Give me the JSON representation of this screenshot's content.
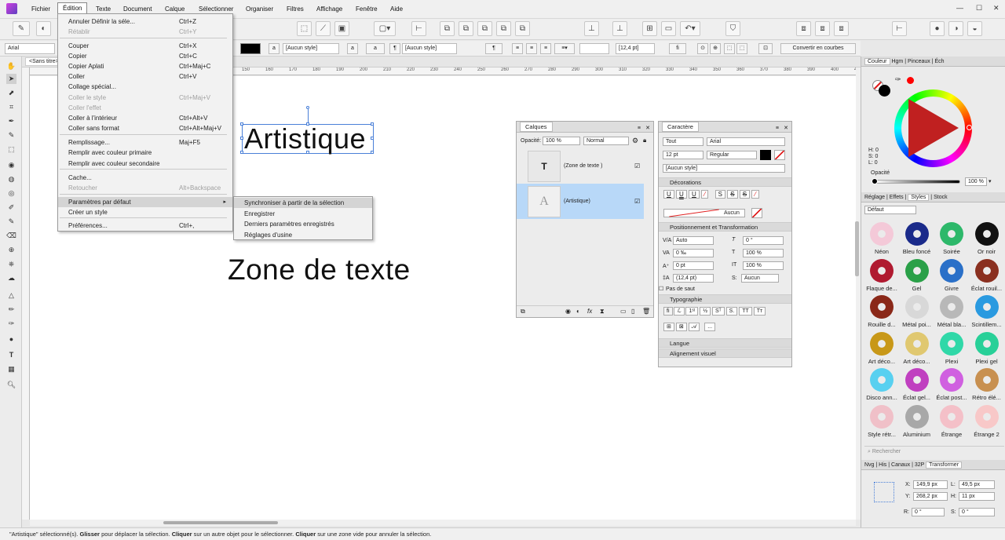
{
  "menubar": {
    "items": [
      "Fichier",
      "Édition",
      "Texte",
      "Document",
      "Calque",
      "Sélectionner",
      "Organiser",
      "Filtres",
      "Affichage",
      "Fenêtre",
      "Aide"
    ],
    "window_controls": [
      "—",
      "☐",
      "✕"
    ]
  },
  "context": {
    "font": "Arial",
    "style1": "[Aucun style]",
    "style2": "[Aucun style]",
    "size": "[12,4 pt]",
    "convert": "Convertir en courbes"
  },
  "document": {
    "tab": "<Sans titre>"
  },
  "ruler": {
    "ticks": [
      "150",
      "160",
      "170",
      "180",
      "190",
      "200",
      "210",
      "220",
      "230",
      "240",
      "250",
      "260",
      "270",
      "280",
      "290",
      "300",
      "310",
      "320",
      "330",
      "340",
      "350",
      "360",
      "370",
      "380",
      "390",
      "400",
      "410",
      "420",
      "430",
      "440",
      "450",
      "460",
      "470",
      "480",
      "490",
      "500",
      "510",
      "520",
      "530",
      "540",
      "550",
      "560",
      "570",
      "580",
      "590",
      "600",
      "610",
      "620",
      "630",
      "640",
      "650",
      "660",
      "670",
      "680",
      "690",
      "700",
      "710",
      "720",
      "730",
      "740",
      "750",
      "760",
      "770",
      "780",
      "790",
      "800",
      "810",
      "820",
      "830",
      "840"
    ]
  },
  "canvas": {
    "artistic": "Artistique",
    "frame": "Zone de texte"
  },
  "edit_menu": {
    "rows": [
      {
        "label": "Annuler Définir la séle...",
        "shortcut": "Ctrl+Z",
        "disabled": false
      },
      {
        "label": "Rétablir",
        "shortcut": "Ctrl+Y",
        "disabled": true
      },
      {
        "label": "Couper",
        "shortcut": "Ctrl+X",
        "disabled": false
      },
      {
        "label": "Copier",
        "shortcut": "Ctrl+C",
        "disabled": false
      },
      {
        "label": "Copier Aplati",
        "shortcut": "Ctrl+Maj+C",
        "disabled": false
      },
      {
        "label": "Coller",
        "shortcut": "Ctrl+V",
        "disabled": false
      },
      {
        "label": "Collage spécial...",
        "shortcut": "",
        "disabled": false
      },
      {
        "label": "Coller le style",
        "shortcut": "Ctrl+Maj+V",
        "disabled": true
      },
      {
        "label": "Coller l'effet",
        "shortcut": "",
        "disabled": true
      },
      {
        "label": "Coller à l'intérieur",
        "shortcut": "Ctrl+Alt+V",
        "disabled": false
      },
      {
        "label": "Coller sans format",
        "shortcut": "Ctrl+Alt+Maj+V",
        "disabled": false
      },
      {
        "label": "Remplissage...",
        "shortcut": "Maj+F5",
        "disabled": false
      },
      {
        "label": "Remplir avec couleur primaire",
        "shortcut": "",
        "disabled": false
      },
      {
        "label": "Remplir avec couleur secondaire",
        "shortcut": "",
        "disabled": false
      },
      {
        "label": "Cache...",
        "shortcut": "",
        "disabled": false
      },
      {
        "label": "Retoucher",
        "shortcut": "Alt+Backspace",
        "disabled": true
      },
      {
        "label": "Paramètres par défaut",
        "shortcut": "",
        "disabled": false
      },
      {
        "label": "Créer un style",
        "shortcut": "",
        "disabled": false
      },
      {
        "label": "Préférences...",
        "shortcut": "Ctrl+,",
        "disabled": false
      }
    ]
  },
  "submenu": {
    "rows": [
      "Synchroniser à partir de la sélection",
      "Enregistrer",
      "Derniers paramètres enregistrés",
      "Réglages d'usine"
    ]
  },
  "layers": {
    "title": "Calques",
    "opacity_label": "Opacité:",
    "opacity": "100 %",
    "blend": "Normal",
    "items": [
      {
        "name": "(Zone de texte )",
        "thumb": "T"
      },
      {
        "name": "(Artistique)",
        "thumb": "A"
      }
    ]
  },
  "character": {
    "title": "Caractère",
    "scope": "Tout",
    "font": "Arial",
    "size": "12 pt",
    "weight": "Regular",
    "style": "[Aucun style]",
    "sect_deco": "Décorations",
    "deco_none": "Aucun",
    "sect_pos": "Positionnement et Transformation",
    "kern": "Auto",
    "skew": "0 °",
    "track": "0 ‰",
    "vscale": "100 %",
    "baseline": "0 pt",
    "hscale": "100 %",
    "leading": "(12,4 pt)",
    "lang_none": "Aucun",
    "no_break": "Pas de saut",
    "sect_typo": "Typographie",
    "sect_lang": "Langue",
    "sect_visual": "Alignement visuel"
  },
  "color_panel": {
    "tabs": [
      "Couleur",
      "Hgm",
      "Pinceaux",
      "Éch"
    ],
    "h": "H: 0",
    "s": "S: 0",
    "l": "L: 0",
    "opacity_label": "Opacité",
    "opacity": "100 %",
    "primary": "#000000",
    "secondary": "#ff0000"
  },
  "styles_panel": {
    "tabs": [
      "Réglage",
      "Effets",
      "Styles",
      "Stock"
    ],
    "category": "Défaut",
    "items": [
      {
        "name": "Néon",
        "color": "#f4c9d8"
      },
      {
        "name": "Bleu foncé",
        "color": "#1a2a8a"
      },
      {
        "name": "Soirée",
        "color": "#2db86a"
      },
      {
        "name": "Or noir",
        "color": "#111111"
      },
      {
        "name": "Flaque de...",
        "color": "#b01a30"
      },
      {
        "name": "Gel",
        "color": "#2aa048"
      },
      {
        "name": "Givre",
        "color": "#2a70c8"
      },
      {
        "name": "Éclat rouil...",
        "color": "#8a3020"
      },
      {
        "name": "Rouille d...",
        "color": "#8a2818"
      },
      {
        "name": "Métal poi...",
        "color": "#d8d8d8"
      },
      {
        "name": "Métal bla...",
        "color": "#b8b8b8"
      },
      {
        "name": "Scintillem...",
        "color": "#2a9ae0"
      },
      {
        "name": "Art déco...",
        "color": "#c89818"
      },
      {
        "name": "Art déco...",
        "color": "#e0c870"
      },
      {
        "name": "Plexi",
        "color": "#30d8a8"
      },
      {
        "name": "Plexi gel",
        "color": "#28d098"
      },
      {
        "name": "Disco ann...",
        "color": "#58d0f0"
      },
      {
        "name": "Éclat gel...",
        "color": "#c040c0"
      },
      {
        "name": "Éclat post...",
        "color": "#d060e0"
      },
      {
        "name": "Rétro élé...",
        "color": "#c89050"
      },
      {
        "name": "Style rétr...",
        "color": "#f0c0c8"
      },
      {
        "name": "Aluminium",
        "color": "#a8a8a8"
      },
      {
        "name": "Étrange",
        "color": "#f4c0c8"
      },
      {
        "name": "Étrange 2",
        "color": "#f8c8c8"
      }
    ],
    "search_placeholder": "Rechercher"
  },
  "transform_panel": {
    "tabs": [
      "Nvg",
      "His",
      "Canaux",
      "32P",
      "Transformer"
    ],
    "x": "149,9 px",
    "y": "268,2 px",
    "w": "49,5 px",
    "h": "11 px",
    "r": "0 °",
    "s": "0 °"
  },
  "status": {
    "q": "\"Artistique\" sélectionné(s).",
    "b1": "Glisser",
    "t1": " pour déplacer la sélection. ",
    "b2": "Cliquer",
    "t2": " sur un autre objet pour le sélectionner. ",
    "b3": "Cliquer",
    "t3": " sur une zone vide pour annuler la sélection."
  }
}
